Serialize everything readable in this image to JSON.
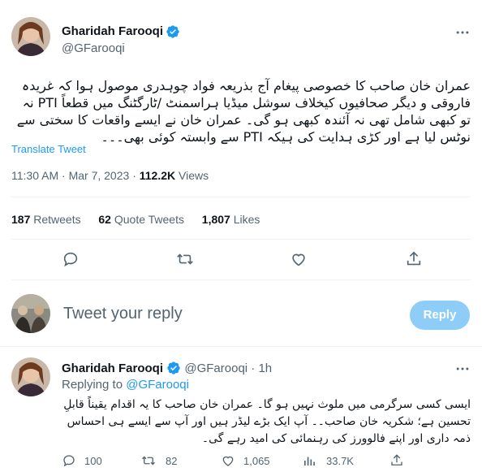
{
  "colors": {
    "accent": "#1d9bf0",
    "muted": "#536471",
    "text": "#0f1419",
    "reply_button": "#8ecdf8"
  },
  "tweet": {
    "author_name": "Gharidah Farooqi",
    "author_handle": "@GFarooqi",
    "more_icon": "more-horizontal-icon",
    "text_lines": [
      "عمران خان صاحب کا خصوصی پیغام آج بذریعہ فواد چوہدری موصول ہوا کہ غریدہ",
      "فاروقی و دیگر صحافیوں کیخلاف سوشل میڈیا ہراسمنٹ /ٹارگٹنگ میں قطعاً PTI نہ",
      "تو کبھی شامل تھی نہ آئندہ کبھی ہو گی۔ عمران خان نے ایسے واقعات کا سختی سے",
      "نوٹس لیا ہے اور کڑی ہدایت کی ہیکہ PTI سے وابستہ کوئی بھی۔۔۔"
    ],
    "translate_label": "Translate Tweet",
    "time": "11:30 AM",
    "date": "Mar 7, 2023",
    "views_count": "112.2K",
    "views_label": "Views",
    "retweets_count": "187",
    "retweets_label": "Retweets",
    "quotes_count": "62",
    "quotes_label": "Quote Tweets",
    "likes_count": "1,807",
    "likes_label": "Likes"
  },
  "compose": {
    "placeholder": "Tweet your reply",
    "reply_button": "Reply"
  },
  "reply": {
    "author_name": "Gharidah Farooqi",
    "author_handle": "@GFarooqi",
    "time_ago": "· 1h",
    "replying_to_label": "Replying to",
    "replying_to_handle": "@GFarooqi",
    "text_lines": [
      "ایسی کسی سرگرمی میں ملوث نہیں ہو گا۔ عمران خان صاحب کا یہ اقدام یقیناً قابلِ",
      "تحسین ہے؛ شکریہ خان صاحب۔۔ آپ ایک بڑے لیڈر ہیں اور آپ سے ایسے ہی احساس",
      "ذمہ داری اور اپنے فالوورز کی رہنمائی کی امید رہے گی۔"
    ],
    "replies_count": "100",
    "retweets_count": "82",
    "likes_count": "1,065",
    "views_count": "33.7K"
  }
}
